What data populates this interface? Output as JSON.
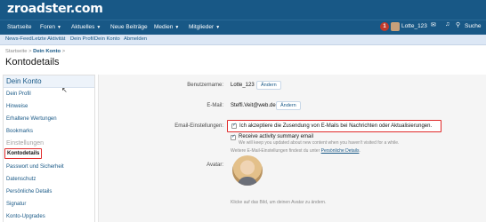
{
  "header": {
    "logo": "zroadster.com",
    "notification_count": "1",
    "user": "Lotte_123",
    "search_label": "Suche"
  },
  "nav": {
    "items": [
      "Startseite",
      "Foren",
      "Aktuelles",
      "Neue Beiträge",
      "Medien",
      "Mitglieder"
    ]
  },
  "subnav": {
    "items": [
      "News-Feed",
      "Letzte Aktivität",
      "Dein Profil",
      "Dein Konto",
      "Abmelden"
    ]
  },
  "breadcrumb": {
    "home": "Startseite",
    "separator": ">",
    "current": "Dein Konto",
    "trail_end": ">"
  },
  "page_title": "Kontodetails",
  "sidebar": {
    "header": "Dein Konto",
    "items": [
      "Dein Profil",
      "Hinweise",
      "Erhaltene Wertungen",
      "Bookmarks"
    ],
    "section": "Einstellungen",
    "active": "Kontodetails",
    "settings_items": [
      "Passwort und Sicherheit",
      "Datenschutz",
      "Persönliche Details",
      "Signatur",
      "Konto-Upgrades"
    ]
  },
  "form": {
    "username_label": "Benutzername:",
    "username_value": "Lotte_123",
    "change_label": "Ändern",
    "email_label": "E-Mail:",
    "email_value": "Steffi.Veit@web.de",
    "email_settings_label": "Email-Einstellungen:",
    "email_consent": "Ich akzeptiere die Zusendung von E-Mails bei Nachrichten oder Aktualisierungen.",
    "activity_summary": "Receive activity summary email",
    "activity_hint": "We will keep you updated about new content when you haven't visited for a while.",
    "more_settings_prefix": "Weitere E-Mail-Einstellungen findest du unter ",
    "more_settings_link": "Persönliche Details",
    "more_settings_suffix": ".",
    "avatar_label": "Avatar:",
    "avatar_hint": "Klicke auf das Bild, um deinen Avatar zu ändern."
  }
}
